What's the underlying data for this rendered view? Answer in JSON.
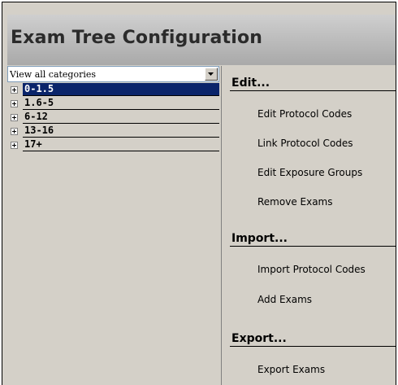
{
  "header": {
    "title": "Exam Tree Configuration"
  },
  "category_filter": {
    "selected": "View all categories"
  },
  "tree": {
    "items": [
      {
        "label": "0-1.5",
        "selected": true
      },
      {
        "label": "1.6-5",
        "selected": false
      },
      {
        "label": "6-12",
        "selected": false
      },
      {
        "label": "13-16",
        "selected": false
      },
      {
        "label": "17+",
        "selected": false
      }
    ]
  },
  "sections": {
    "edit": {
      "title": "Edit...",
      "actions": [
        "Edit Protocol Codes",
        "Link Protocol Codes",
        "Edit Exposure Groups",
        "Remove Exams"
      ]
    },
    "import": {
      "title": "Import...",
      "actions": [
        "Import Protocol Codes",
        "Add Exams"
      ]
    },
    "export": {
      "title": "Export...",
      "actions": [
        "Export Exams"
      ]
    }
  },
  "colors": {
    "selection": "#0a246a",
    "panel": "#d4d0c8",
    "header_top": "#cfcfcf",
    "header_bottom": "#a9a9a9"
  }
}
